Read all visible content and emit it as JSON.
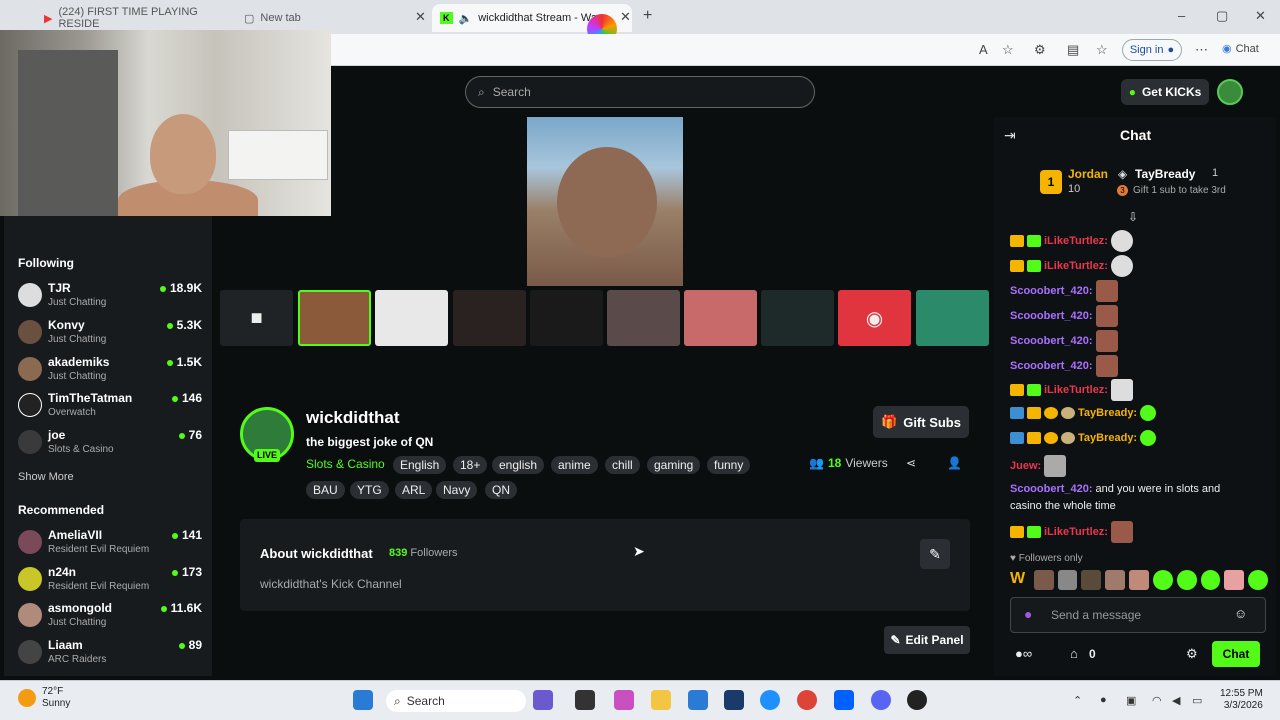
{
  "browser": {
    "tabs": [
      {
        "label": "(224) FIRST TIME PLAYING RESIDE"
      },
      {
        "label": "New tab"
      },
      {
        "label": "wickdidthat Stream - Wa"
      }
    ],
    "signin_label": "Sign in",
    "copilot_label": "Chat"
  },
  "header": {
    "search_placeholder": "Search",
    "get_kicks_label": "Get KICKs"
  },
  "sidebar": {
    "following_title": "Following",
    "following": [
      {
        "name": "TJR",
        "category": "Just Chatting",
        "viewers": "18.9K"
      },
      {
        "name": "Konvy",
        "category": "Just Chatting",
        "viewers": "5.3K"
      },
      {
        "name": "akademiks",
        "category": "Just Chatting",
        "viewers": "1.5K"
      },
      {
        "name": "TimTheTatman",
        "category": "Overwatch",
        "viewers": "146"
      },
      {
        "name": "joe",
        "category": "Slots & Casino",
        "viewers": "76"
      }
    ],
    "show_more": "Show More",
    "recommended_title": "Recommended",
    "recommended": [
      {
        "name": "AmeliaVII",
        "category": "Resident Evil Requiem",
        "viewers": "141"
      },
      {
        "name": "n24n",
        "category": "Resident Evil Requiem",
        "viewers": "173"
      },
      {
        "name": "asmongold",
        "category": "Just Chatting",
        "viewers": "11.6K"
      },
      {
        "name": "Liaam",
        "category": "ARC Raiders",
        "viewers": "89"
      }
    ]
  },
  "stream": {
    "live_label": "LIVE",
    "channel_name": "wickdidthat",
    "title": "the biggest joke of QN",
    "category": "Slots & Casino",
    "tags": [
      "English",
      "18+",
      "english",
      "anime",
      "chill",
      "gaming",
      "funny",
      "BAU",
      "YTG",
      "ARL",
      "Navy",
      "QN"
    ],
    "gift_subs_label": "Gift Subs",
    "viewers_count": "18",
    "viewers_label": "Viewers"
  },
  "about": {
    "title": "About wickdidthat",
    "followers_count": "839",
    "followers_label": "Followers",
    "description": "wickdidthat's Kick Channel",
    "edit_panel_label": "Edit Panel"
  },
  "chat": {
    "title": "Chat",
    "leaderboard": [
      {
        "rank": "1",
        "name": "Jordan",
        "count": "10"
      },
      {
        "name": "TayBready",
        "count": "1",
        "note": "Gift 1 sub to take 3rd",
        "note_rank": "3"
      }
    ],
    "messages": [
      {
        "user": "iLikeTurtlez:",
        "text": "",
        "color": "#e8384f"
      },
      {
        "user": "iLikeTurtlez:",
        "text": "",
        "color": "#e8384f"
      },
      {
        "user": "Scooobert_420:",
        "text": "",
        "color": "#a970ff"
      },
      {
        "user": "Scooobert_420:",
        "text": "",
        "color": "#a970ff"
      },
      {
        "user": "Scooobert_420:",
        "text": "",
        "color": "#a970ff"
      },
      {
        "user": "Scooobert_420:",
        "text": "",
        "color": "#a970ff"
      },
      {
        "user": "iLikeTurtlez:",
        "text": "",
        "color": "#e8384f"
      },
      {
        "user": "TayBready:",
        "text": "",
        "color": "#f4b400"
      },
      {
        "user": "TayBready:",
        "text": "",
        "color": "#f4b400"
      },
      {
        "user": "Juew:",
        "text": "",
        "color": "#e8384f"
      },
      {
        "user": "Scooobert_420:",
        "text": "and you were in slots and",
        "color": "#a970ff"
      },
      {
        "user": "",
        "text": "casino the whole time",
        "color": "#a970ff"
      },
      {
        "user": "iLikeTurtlez:",
        "text": "",
        "color": "#e8384f"
      }
    ],
    "followers_only": "Followers only",
    "input_placeholder": "Send a message",
    "footer_count": "0",
    "chat_button": "Chat"
  },
  "taskbar": {
    "temperature": "72°F",
    "weather": "Sunny",
    "search_label": "Search",
    "time": "12:55 PM",
    "date": "3/3/2026"
  },
  "colors": {
    "accent": "#53fc18",
    "background": "#0b0e0f",
    "panel": "#181b1e"
  },
  "icons": [
    "search-icon",
    "gift-icon",
    "share-icon",
    "person-icon",
    "edit-icon",
    "mic-icon",
    "smile-icon",
    "settings-icon",
    "discord-icon",
    "camera-icon",
    "windows-icon"
  ]
}
